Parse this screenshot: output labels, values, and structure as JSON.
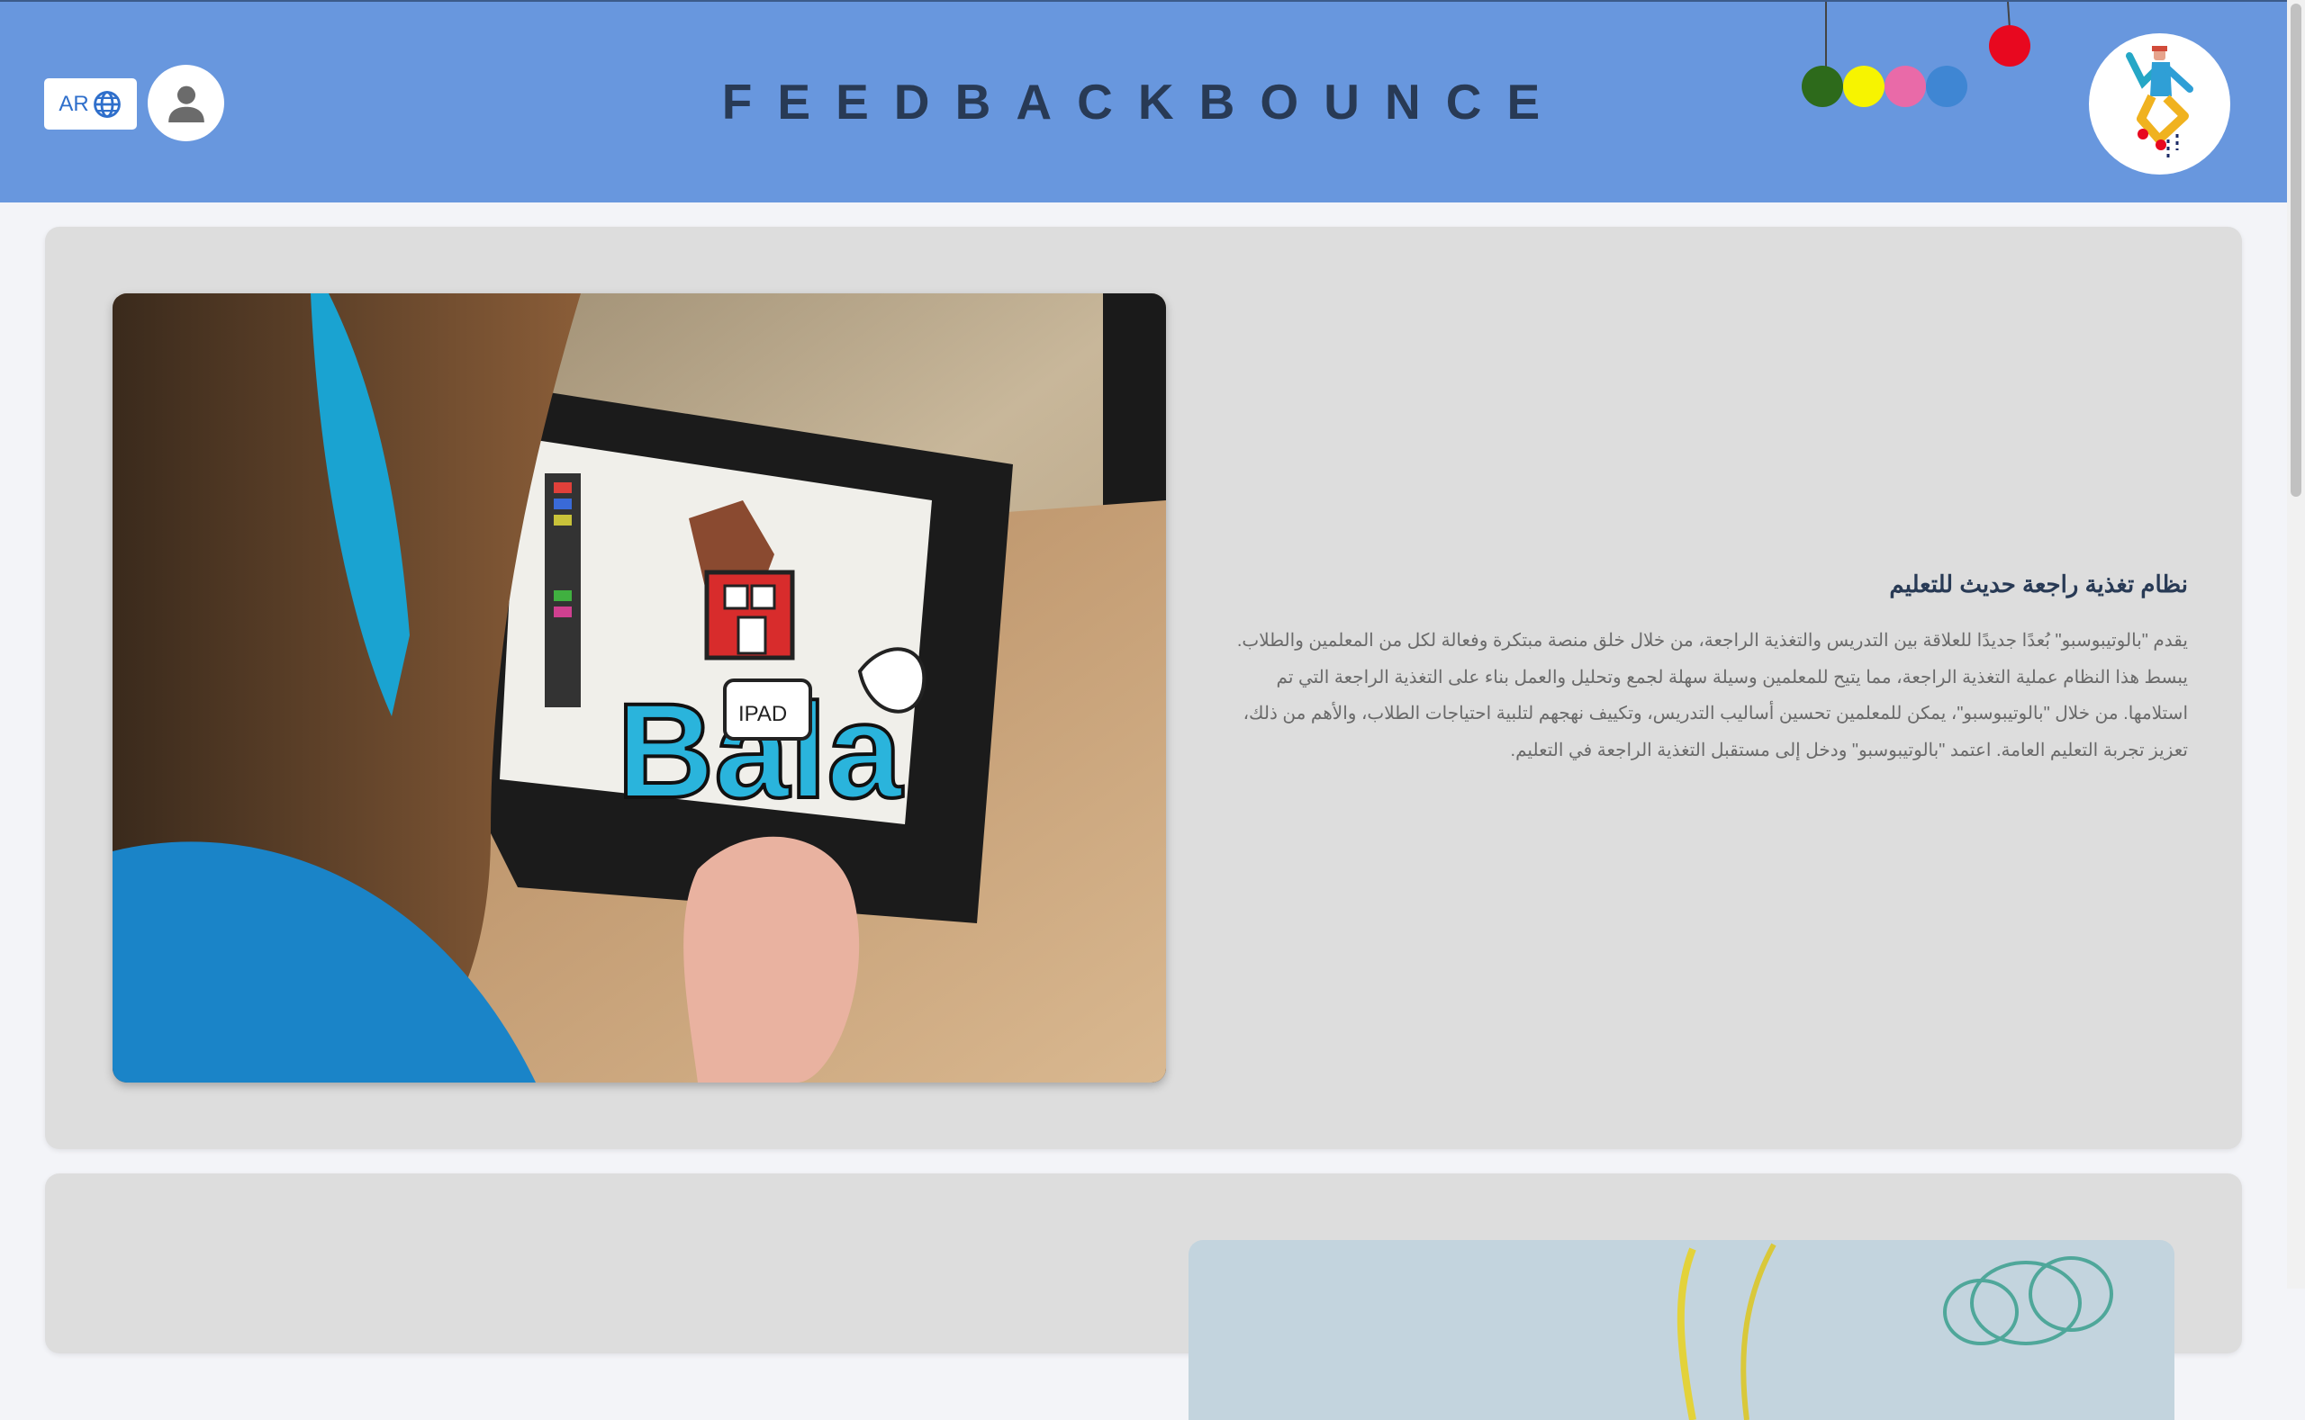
{
  "header": {
    "lang_label": "AR",
    "title": "FEEDBACKBOUNCE",
    "balls": [
      "#2d6a1b",
      "#f7f400",
      "#e96aa8",
      "#3f86d3",
      "#e8081f"
    ]
  },
  "colors": {
    "header_bg": "#6897de",
    "page_bg": "#f3f4f8",
    "card_bg": "#dddddd",
    "title": "#283a55"
  },
  "icons": {
    "language": "globe-icon",
    "account": "user-icon",
    "logo": "logo-figure-icon"
  },
  "main": {
    "section1": {
      "heading": "نظام تغذية راجعة حديث للتعليم",
      "body": "يقدم \"بالوتيبوسبو\" بُعدًا جديدًا للعلاقة بين التدريس والتغذية الراجعة، من خلال خلق منصة مبتكرة وفعالة لكل من المعلمين والطلاب. يبسط هذا النظام عملية التغذية الراجعة، مما يتيح للمعلمين وسيلة سهلة لجمع وتحليل والعمل بناء على التغذية الراجعة التي تم استلامها. من خلال \"بالوتيبوسبو\"، يمكن للمعلمين تحسين أساليب التدريس، وتكييف نهجهم لتلبية احتياجات الطلاب، والأهم من ذلك، تعزيز تجربة التعليم العامة. اعتمد \"بالوتيبوسبو\" ودخل إلى مستقبل التغذية الراجعة في التعليم."
    }
  }
}
